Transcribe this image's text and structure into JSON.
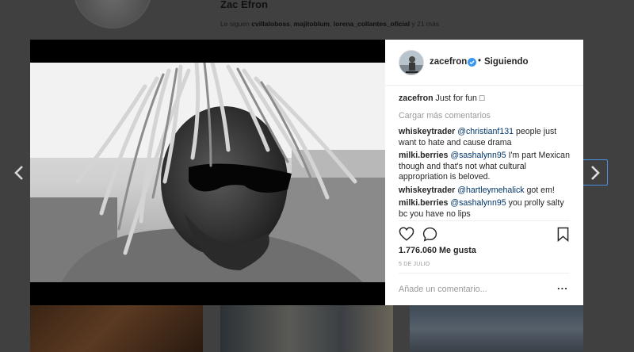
{
  "profile": {
    "name": "Zac Efron",
    "followed_by_prefix": "Le siguen",
    "followed_by": [
      "cvillaloboss",
      "majitoblum",
      "lorena_collantes_oficial"
    ],
    "followed_by_more": "y 21 más"
  },
  "post": {
    "username": "zacefron",
    "verified": true,
    "separator": "•",
    "follow_status": "Siguiendo",
    "caption_user": "zacefron",
    "caption_text": "Just for fun □",
    "load_more": "Cargar más comentarios",
    "comments": [
      {
        "user": "whiskeytrader",
        "mention": "@christianf131",
        "text": "people just want to hate and cause drama"
      },
      {
        "user": "milki.berries",
        "mention": "@sashalynn95",
        "text": "I'm part Mexican though and that's not what cultural appropriation is beloved."
      },
      {
        "user": "whiskeytrader",
        "mention": "@hartleymehalick",
        "text": "got em!"
      },
      {
        "user": "milki.berries",
        "mention": "@sashalynn95",
        "text": "you prolly salty bc you have no lips"
      }
    ],
    "likes": "1.776.060 Me gusta",
    "date": "5 DE JULIO",
    "add_comment_placeholder": "Añade un comentario...",
    "more_label": "..."
  },
  "icons": {
    "prev": "chevron-left-icon",
    "next": "chevron-right-icon",
    "like": "heart-icon",
    "comment": "comment-icon",
    "save": "bookmark-icon",
    "verified": "verified-badge-icon",
    "more": "more-options-icon"
  },
  "colors": {
    "mention": "#003569",
    "verified": "#3897f0",
    "next_focus": "#4a90e2"
  }
}
